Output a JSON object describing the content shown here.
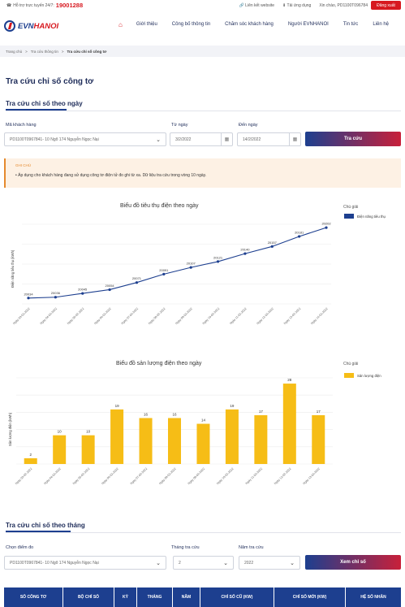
{
  "topbar": {
    "hotline_label": "Hỗ trợ trực tuyến 24/7:",
    "hotline": "19001288",
    "link_website": "Liên kết website",
    "download_app": "Tải ứng dụng",
    "greeting": "Xin chào, PD1100T096784",
    "logout": "Đăng xuất"
  },
  "nav": {
    "logo_a": "EVN",
    "logo_b": "HANOI",
    "home_icon": "⌂",
    "items": [
      "Giới thiệu",
      "Công bố thông tin",
      "Chăm sóc khách hàng",
      "Người EVNHANOI",
      "Tin tức",
      "Liên hệ"
    ]
  },
  "breadcrumb": [
    "Trang chủ",
    ">",
    "Tra cứu thông tin",
    ">",
    "Tra cứu chỉ số công tơ"
  ],
  "page_title": "Tra cứu chỉ số công tơ",
  "daily": {
    "heading": "Tra cứu chỉ số theo ngày",
    "customer_label": "Mã khách hàng",
    "customer_value": "PD1100T0967841- 10 Ngõ 174 Nguyễn Ngọc Nại",
    "from_label": "Từ ngày",
    "from_value": "3/2/2022",
    "to_label": "Đến ngày",
    "to_value": "14/2/2022",
    "button": "Tra cứu"
  },
  "note": {
    "title": "GHI CHÚ",
    "text": "•  Áp dụng cho khách hàng đang sử dụng công tơ điện tử đo ghi từ xa. Dữ liệu tra cứu trong vòng 10 ngày."
  },
  "chart_data": [
    {
      "type": "line",
      "title": "Biểu đồ tiêu thụ điện theo ngày",
      "ylabel": "Điện năng tiêu thụ (kWh)",
      "legend_title": "Chú giải",
      "series": [
        {
          "name": "Điện năng tiêu thụ",
          "values": [
            20034,
            20036,
            20045,
            20054,
            20071,
            20091,
            20107,
            20121,
            20140,
            20157,
            20181,
            20202
          ]
        }
      ],
      "categories": [
        "Ngày 03-02-2022",
        "Ngày 04-02-2022",
        "Ngày 05-02-2022",
        "Ngày 06-02-2022",
        "Ngày 07-02-2022",
        "Ngày 08-02-2022",
        "Ngày 09-02-2022",
        "Ngày 10-02-2022",
        "Ngày 11-02-2022",
        "Ngày 12-02-2022",
        "Ngày 13-02-2022",
        "Ngày 14-02-2022"
      ],
      "color": "#1d3f8f"
    },
    {
      "type": "bar",
      "title": "Biểu đồ sản lượng điện theo ngày",
      "ylabel": "Sản lượng điện (kWh)",
      "legend_title": "Chú giải",
      "series": [
        {
          "name": "Sản lượng điện",
          "values": [
            2,
            10,
            10,
            19,
            16,
            16,
            14,
            19,
            17,
            28,
            17
          ]
        }
      ],
      "categories": [
        "Ngày 03-02-2022",
        "Ngày 04-02-2022",
        "Ngày 05-02-2022",
        "Ngày 06-02-2022",
        "Ngày 07-02-2022",
        "Ngày 08-02-2022",
        "Ngày 09-02-2022",
        "Ngày 10-02-2022",
        "Ngày 11-02-2022",
        "Ngày 12-02-2022",
        "Ngày 13-02-2022"
      ],
      "color": "#f6bd16"
    }
  ],
  "monthly": {
    "heading": "Tra cứu chỉ số theo tháng",
    "point_label": "Chọn điểm đo",
    "point_value": "PD1100T0967841- 10 Ngõ 174 Nguyễn Ngọc Nại",
    "month_label": "Tháng tra cứu",
    "month_value": "2",
    "year_label": "Năm tra cứu",
    "year_value": "2022",
    "button": "Xem chỉ số"
  },
  "table": {
    "headers": [
      "SỐ CÔNG TƠ",
      "BỘ CHỈ SỐ",
      "KỲ",
      "THÁNG",
      "NĂM",
      "CHỈ SỐ CŨ (KW)",
      "CHỈ SỐ MỚI (KW)",
      "HỆ SỐ NHÂN"
    ]
  }
}
